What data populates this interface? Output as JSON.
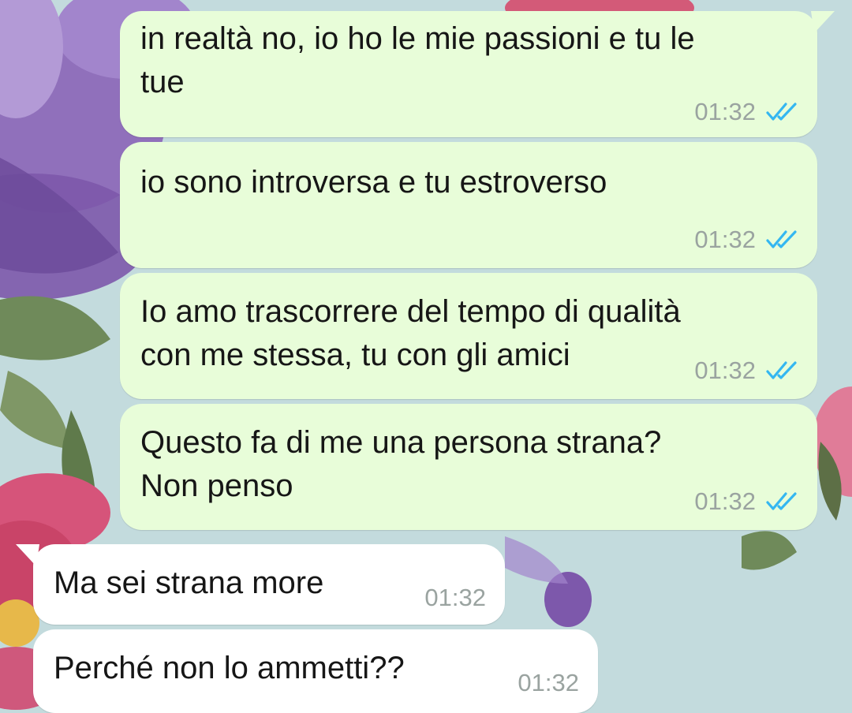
{
  "colors": {
    "outgoing_bubble": "#e8fdd9",
    "incoming_bubble": "#ffffff",
    "timestamp": "#9aa3a0",
    "read_tick": "#34b7f1",
    "wallpaper_base": "#c3dbdd"
  },
  "conversation": {
    "messages": [
      {
        "direction": "outgoing",
        "text": "in realtà no, io ho le mie passioni e tu le\ntue",
        "time": "01:32",
        "status": "read",
        "status_icon": "double-check-icon"
      },
      {
        "direction": "outgoing",
        "text": "io sono introversa e tu estroverso",
        "time": "01:32",
        "status": "read",
        "status_icon": "double-check-icon"
      },
      {
        "direction": "outgoing",
        "text": "Io amo trascorrere del tempo di qualità\ncon me stessa, tu con gli amici",
        "time": "01:32",
        "status": "read",
        "status_icon": "double-check-icon"
      },
      {
        "direction": "outgoing",
        "text": "Questo fa di me una persona strana?\nNon penso",
        "time": "01:32",
        "status": "read",
        "status_icon": "double-check-icon"
      },
      {
        "direction": "incoming",
        "text": "Ma sei strana more",
        "time": "01:32"
      },
      {
        "direction": "incoming",
        "text": "Perché non lo ammetti??",
        "time": "01:32"
      }
    ]
  }
}
